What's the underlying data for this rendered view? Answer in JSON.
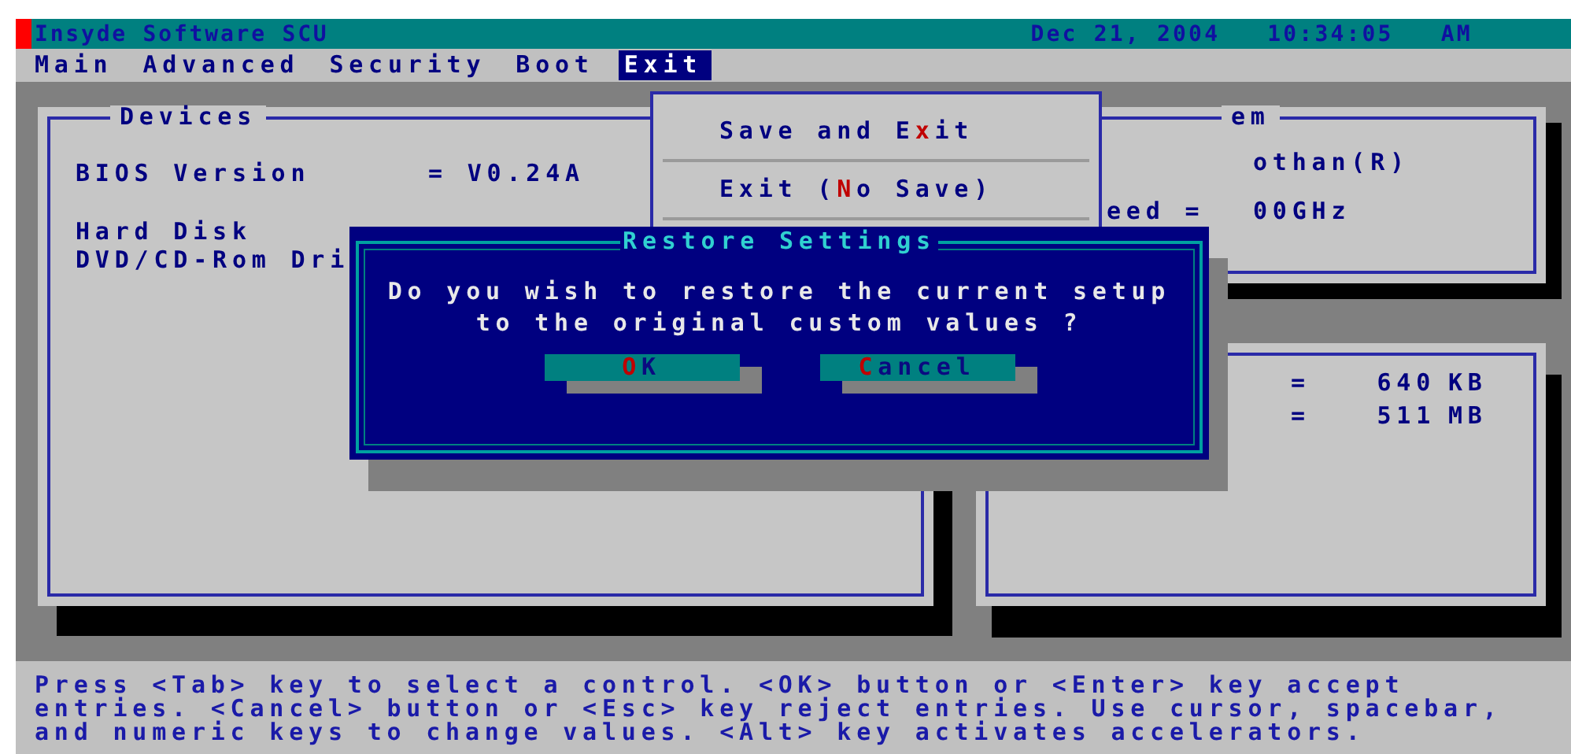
{
  "title_bar": {
    "title": "Insyde Software SCU",
    "date": "Dec 21, 2004",
    "time": "10:34:05",
    "meridiem": "AM"
  },
  "menu_bar": [
    {
      "label": "Main",
      "selected": false
    },
    {
      "label": "Advanced",
      "selected": false
    },
    {
      "label": "Security",
      "selected": false
    },
    {
      "label": "Boot",
      "selected": false
    },
    {
      "label": "Exit",
      "selected": true
    }
  ],
  "devices_panel": {
    "title": "Devices",
    "rows": [
      {
        "label": "BIOS Version",
        "value": "= V0.24A"
      },
      {
        "label": "Hard Disk"
      },
      {
        "label": "DVD/CD-Rom Dri"
      }
    ]
  },
  "system_panel": {
    "title": "em",
    "rows": [
      {
        "value": "othan(R)"
      },
      {
        "label": "eed =",
        "value": "00GHz"
      }
    ]
  },
  "memory_panel": {
    "rows": [
      {
        "sign": "=",
        "value": "640",
        "unit": "KB"
      },
      {
        "sign": "=",
        "value": "511",
        "unit": "MB"
      }
    ]
  },
  "exit_menu": [
    {
      "before": "Save and E",
      "hotkey": "x",
      "after": "it"
    },
    {
      "before": "Exit (",
      "hotkey": "N",
      "after": "o Save)"
    }
  ],
  "dialog": {
    "title": "Restore Settings",
    "message": [
      "Do you wish to restore the current setup",
      "to the original custom values ?"
    ],
    "buttons": [
      {
        "hotkey": "O",
        "after": "K"
      },
      {
        "hotkey": "C",
        "after": "ancel"
      }
    ]
  },
  "help_text": [
    "Press <Tab> key to select a control. <OK> button or <Enter> key accept",
    "entries. <Cancel> button or <Esc> key reject entries. Use cursor, spacebar,",
    "and numeric keys to change values. <Alt> key activates accelerators."
  ]
}
